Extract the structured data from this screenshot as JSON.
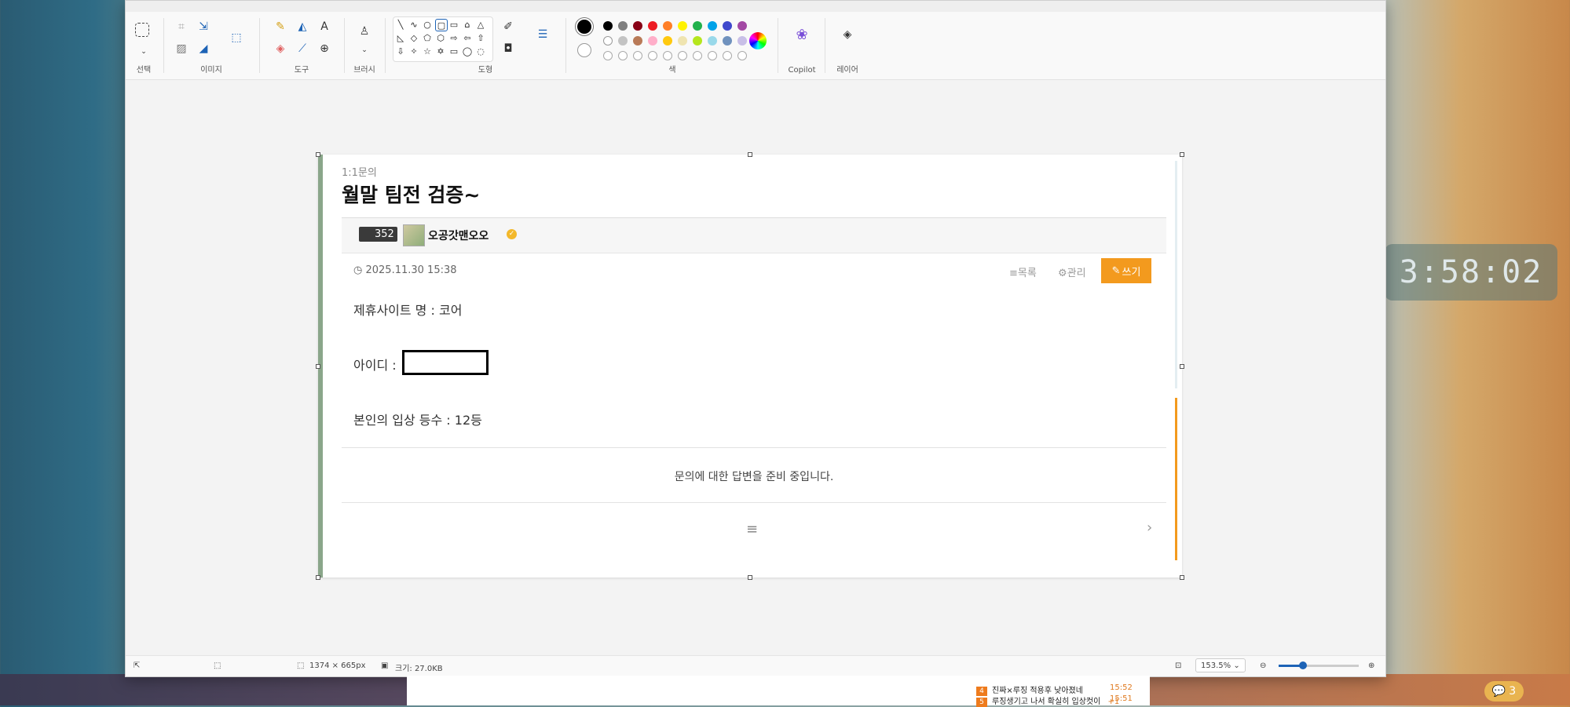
{
  "ribbon": {
    "groups": {
      "select": "선택",
      "image": "이미지",
      "tools": "도구",
      "brush": "브러시",
      "shapes": "도형",
      "color": "색",
      "copilot": "Copilot",
      "layers": "레이어"
    }
  },
  "colors": {
    "row1": [
      "#000000",
      "#7f7f7f",
      "#880015",
      "#ed1c24",
      "#ff7f27",
      "#fff200",
      "#22b14c",
      "#00a2e8",
      "#3f48cc",
      "#a349a4"
    ],
    "row2": [
      "#ffffff",
      "#c3c3c3",
      "#b97a57",
      "#ffaec9",
      "#ffc90e",
      "#efe4b0",
      "#b5e61d",
      "#99d9ea",
      "#7092be",
      "#c8bfe7"
    ],
    "accent": "#f39a1e"
  },
  "doc": {
    "category": "1:1문의",
    "title": "월말 팀전 검증~",
    "level": "352",
    "author": "오공갓맨오오",
    "date": "2025.11.30 15:38",
    "list_btn": "목록",
    "manage_btn": "관리",
    "write_btn": "쓰기",
    "line1": "제휴사이트 명 : 코어",
    "line2": "아이디 :",
    "line3": "본인의 입상 등수 : 12등",
    "reply_notice": "문의에 대한 답변을 준비 중입니다."
  },
  "status": {
    "dimensions": "1374 × 665px",
    "size": "크기: 27.0KB",
    "zoom": "153.5%",
    "zoom_level": 0.3
  },
  "clock": "3:58:02",
  "news": [
    {
      "num": "4",
      "text": "진짜×루징 적용후 낮아졌네",
      "time": "15:52"
    },
    {
      "num": "5",
      "text": "루징생기고 나서 확실히 입상컷이",
      "extra": "+1",
      "time": "15:51"
    }
  ],
  "chat_count": "3"
}
